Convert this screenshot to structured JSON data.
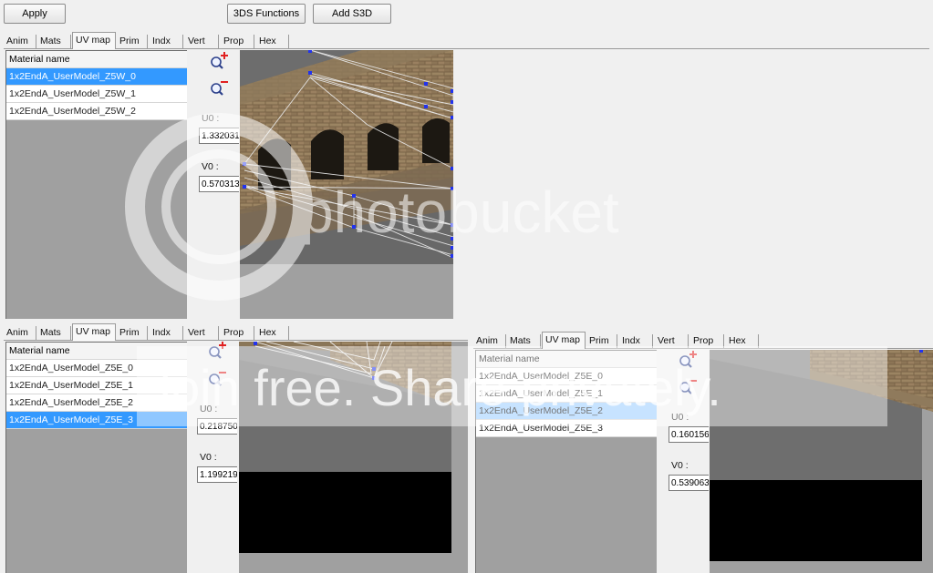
{
  "toolbar": {
    "apply_label": "Apply",
    "functions_label": "3DS Functions",
    "add_label": "Add S3D"
  },
  "tabs": [
    "Anim",
    "Mats",
    "UV map",
    "Prim",
    "Indx",
    "Vert",
    "Prop",
    "Hex"
  ],
  "panel_top": {
    "list_header": "Material name",
    "items": [
      "1x2EndA_UserModel_Z5W_0",
      "1x2EndA_UserModel_Z5W_1",
      "1x2EndA_UserModel_Z5W_2"
    ],
    "u0_label": "U0 :",
    "u0_value": "1.332031",
    "v0_label": "V0 :",
    "v0_value": "0.570313"
  },
  "panel_bottom_left": {
    "list_header": "Material name",
    "items": [
      "1x2EndA_UserModel_Z5E_0",
      "1x2EndA_UserModel_Z5E_1",
      "1x2EndA_UserModel_Z5E_2",
      "1x2EndA_UserModel_Z5E_3"
    ],
    "u0_label": "U0 :",
    "u0_value": "0.218750",
    "v0_label": "V0 :",
    "v0_value": "1.199219"
  },
  "panel_bottom_right": {
    "list_header": "Material name",
    "items": [
      "1x2EndA_UserModel_Z5E_0",
      "1x2EndA_UserModel_Z5E_1",
      "1x2EndA_UserModel_Z5E_2",
      "1x2EndA_UserModel_Z5E_3"
    ],
    "u0_label": "U0 :",
    "u0_value": "0.160156",
    "v0_label": "V0 :",
    "v0_value": "0.539063"
  },
  "watermark": {
    "brand": "photobucket",
    "tagline": "Join free. Share privately."
  }
}
